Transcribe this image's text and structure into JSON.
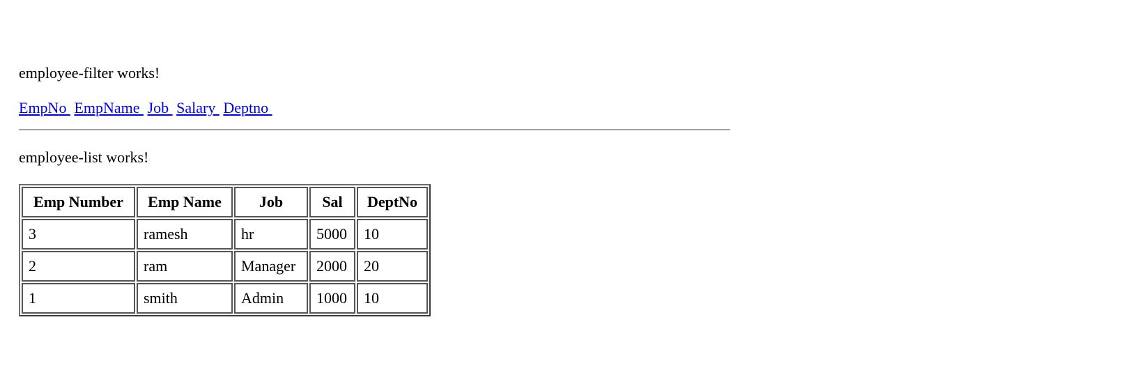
{
  "filter": {
    "title": "employee-filter works!",
    "links": [
      {
        "label": "EmpNo "
      },
      {
        "label": "EmpName "
      },
      {
        "label": "Job "
      },
      {
        "label": "Salary "
      },
      {
        "label": "Deptno "
      }
    ]
  },
  "list": {
    "title": "employee-list works!",
    "columns": [
      "Emp Number",
      "Emp Name",
      "Job",
      "Sal",
      "DeptNo"
    ],
    "rows": [
      [
        "3",
        "ramesh",
        "hr",
        "5000",
        "10"
      ],
      [
        "2",
        "ram",
        "Manager",
        "2000",
        "20"
      ],
      [
        "1",
        "smith",
        "Admin",
        "1000",
        "10"
      ]
    ]
  },
  "colors": {
    "link": "#0000ee",
    "divider": "#a0a0a0",
    "table_border": "#555555"
  }
}
